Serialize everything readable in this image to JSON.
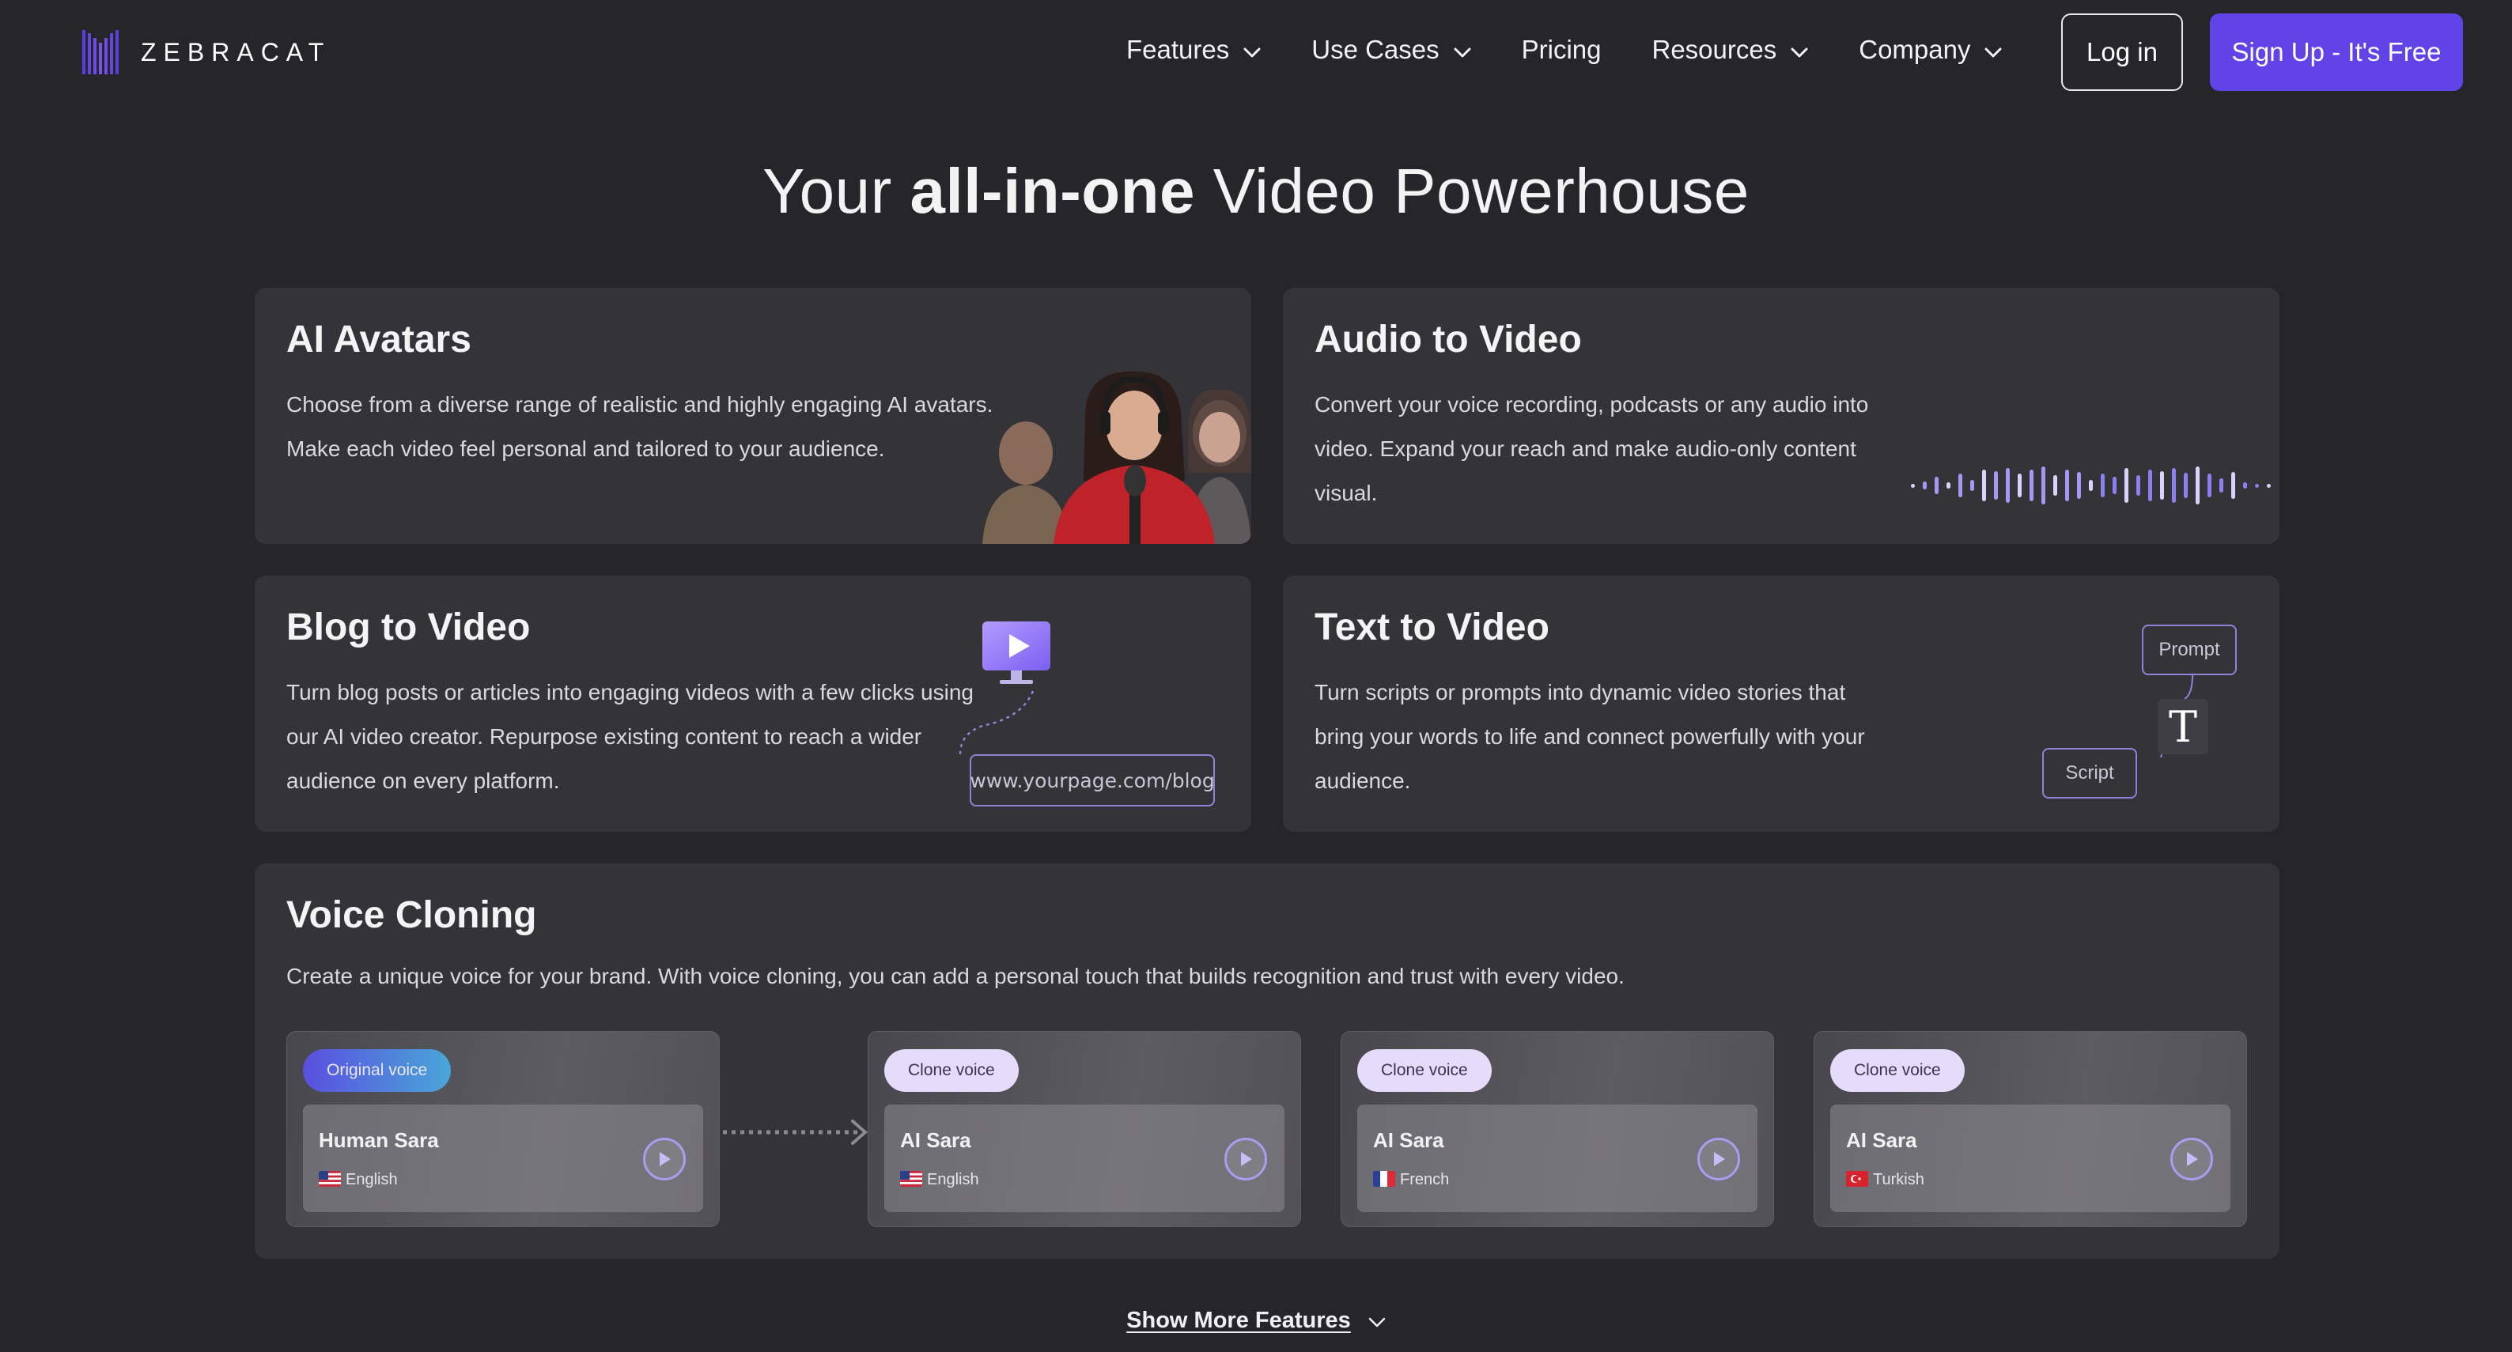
{
  "nav": {
    "brand": "ZEBRACAT",
    "links": [
      {
        "label": "Features",
        "dropdown": true
      },
      {
        "label": "Use Cases",
        "dropdown": true
      },
      {
        "label": "Pricing",
        "dropdown": false
      },
      {
        "label": "Resources",
        "dropdown": true
      },
      {
        "label": "Company",
        "dropdown": true
      }
    ],
    "login_label": "Log in",
    "signup_label": "Sign Up - It's Free"
  },
  "hero": {
    "title_prefix": "Your ",
    "title_bold": "all-in-one",
    "title_suffix": " Video Powerhouse"
  },
  "features": {
    "avatars": {
      "title": "AI Avatars",
      "desc": "Choose from a diverse range of realistic and highly engaging AI avatars. Make each video feel personal and tailored to your audience."
    },
    "audio": {
      "title": "Audio to Video",
      "desc": "Convert your voice recording, podcasts or any audio into video. Expand your reach and make audio-only content visual."
    },
    "blog": {
      "title": "Blog to Video",
      "desc": "Turn blog posts or articles into engaging videos with a few clicks using our AI video creator. Repurpose existing content to reach a wider audience on every platform.",
      "url": "www.yourpage.com/blog"
    },
    "text": {
      "title": "Text to Video",
      "desc": "Turn scripts or prompts into dynamic video stories that bring your words to life and connect powerfully with your audience.",
      "prompt_label": "Prompt",
      "script_label": "Script",
      "t_glyph": "T"
    },
    "voice": {
      "title": "Voice Cloning",
      "desc": "Create a unique voice for your brand. With voice cloning, you can add a personal touch that builds recognition and trust with every video.",
      "cards": [
        {
          "tag": "Original voice",
          "name": "Human Sara",
          "language": "English",
          "flag": "us"
        },
        {
          "tag": "Clone voice",
          "name": "AI Sara",
          "language": "English",
          "flag": "us"
        },
        {
          "tag": "Clone voice",
          "name": "AI Sara",
          "language": "French",
          "flag": "fr"
        },
        {
          "tag": "Clone voice",
          "name": "AI Sara",
          "language": "Turkish",
          "flag": "tr"
        }
      ]
    }
  },
  "show_more_label": "Show More Features",
  "colors": {
    "background": "#262529",
    "card": "#343338",
    "accent": "#6144e8"
  }
}
